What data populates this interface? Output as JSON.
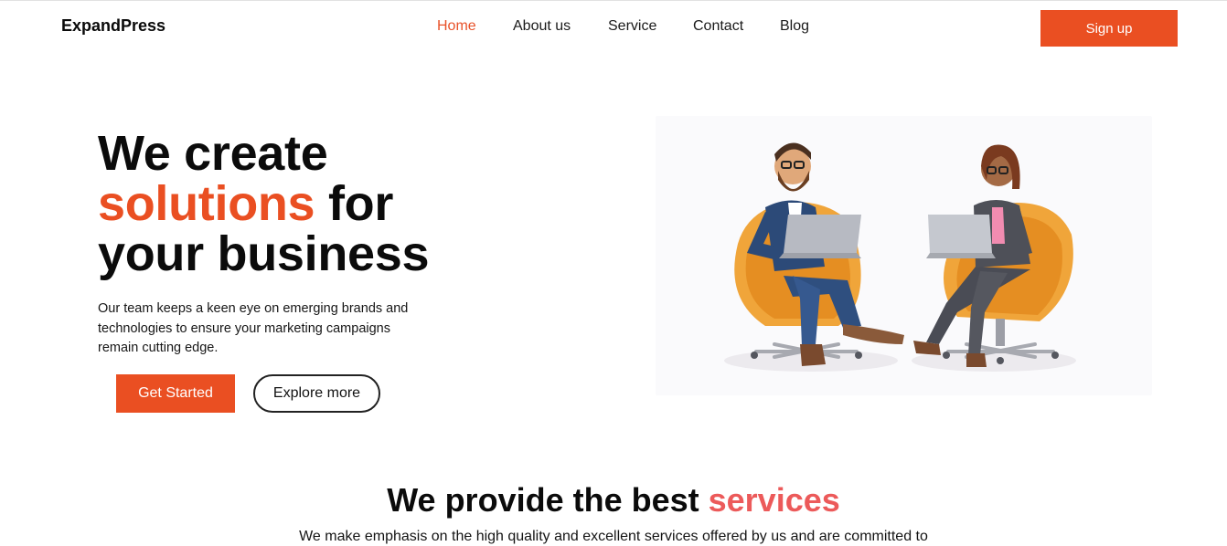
{
  "brand": "ExpandPress",
  "nav": {
    "items": [
      {
        "label": "Home",
        "active": true
      },
      {
        "label": "About us"
      },
      {
        "label": "Service"
      },
      {
        "label": "Contact"
      },
      {
        "label": "Blog"
      }
    ]
  },
  "signup_label": "Sign up",
  "hero": {
    "title_line1": "We create",
    "title_accent": "solutions",
    "title_rest2": " for",
    "title_line3": "your business",
    "description": "Our team keeps a keen eye on emerging brands and technologies to ensure your marketing campaigns remain cutting edge.",
    "primary_cta": "Get Started",
    "secondary_cta": "Explore more"
  },
  "services": {
    "title_prefix": "We provide the best ",
    "title_accent": "services",
    "description": "We make emphasis on the high quality and excellent services offered by us and are committed to"
  },
  "colors": {
    "accent": "#ea4f22",
    "accent_soft": "#ec5a5a",
    "text": "#0b0b0b"
  }
}
